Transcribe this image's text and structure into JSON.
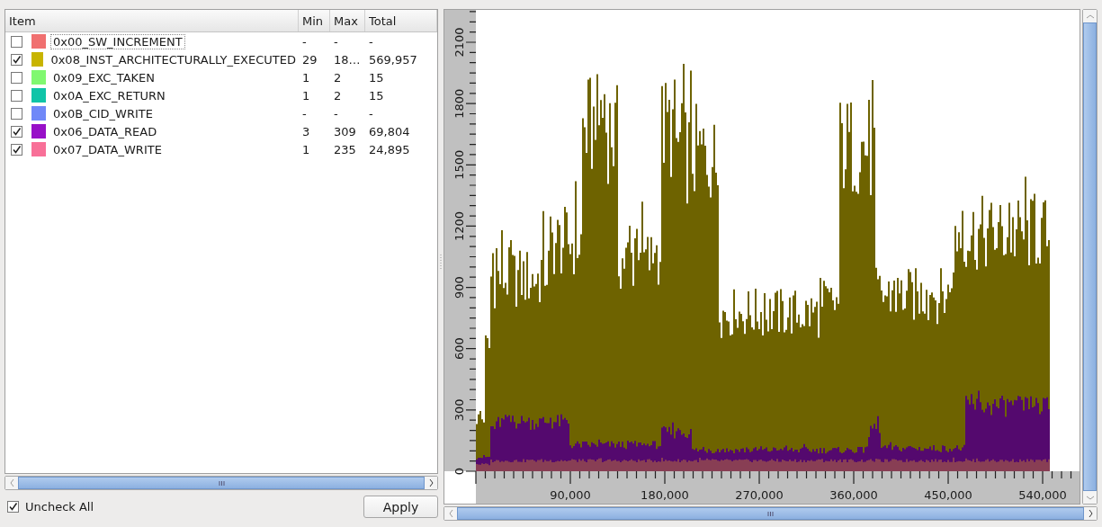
{
  "table": {
    "columns": [
      "Item",
      "Min",
      "Max",
      "Total"
    ],
    "rows": [
      {
        "checked": false,
        "focused": true,
        "color": "#f07070",
        "name": "0x00_SW_INCREMENT",
        "min": "-",
        "max": "-",
        "total": "-"
      },
      {
        "checked": true,
        "focused": false,
        "color": "#c8b400",
        "name": "0x08_INST_ARCHITECTURALLY_EXECUTED",
        "min": "29",
        "max": "18…",
        "total": "569,957"
      },
      {
        "checked": false,
        "focused": false,
        "color": "#80f870",
        "name": "0x09_EXC_TAKEN",
        "min": "1",
        "max": "2",
        "total": "15"
      },
      {
        "checked": false,
        "focused": false,
        "color": "#10c4a8",
        "name": "0x0A_EXC_RETURN",
        "min": "1",
        "max": "2",
        "total": "15"
      },
      {
        "checked": false,
        "focused": false,
        "color": "#7088f8",
        "name": "0x0B_CID_WRITE",
        "min": "-",
        "max": "-",
        "total": "-"
      },
      {
        "checked": true,
        "focused": false,
        "color": "#9810c8",
        "name": "0x06_DATA_READ",
        "min": "3",
        "max": "309",
        "total": "69,804"
      },
      {
        "checked": true,
        "focused": false,
        "color": "#f87098",
        "name": "0x07_DATA_WRITE",
        "min": "1",
        "max": "235",
        "total": "24,895"
      }
    ]
  },
  "uncheck_all": {
    "label": "Uncheck All",
    "checked": true
  },
  "apply_button": "Apply",
  "chart": {
    "y_tick_labels": [
      "0",
      "300",
      "600",
      "900",
      "1200",
      "1500",
      "1800",
      "2100"
    ],
    "x_tick_labels": [
      "90,000",
      "180,000",
      "270,000",
      "360,000",
      "450,000",
      "540,000"
    ]
  }
}
